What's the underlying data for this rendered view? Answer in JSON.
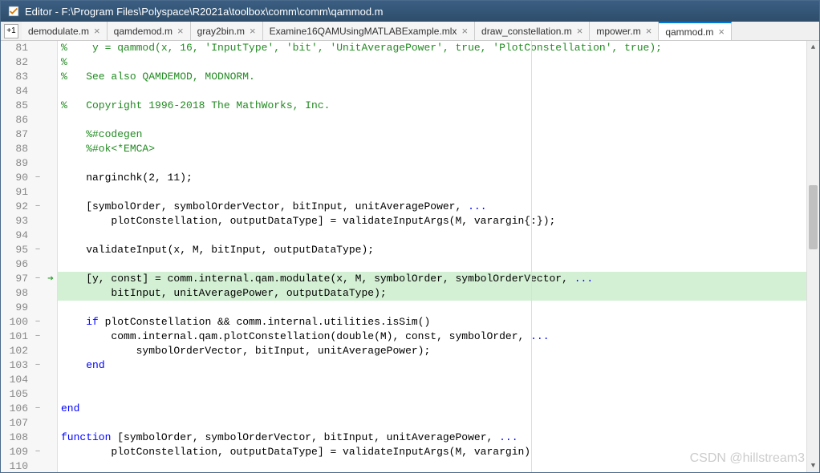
{
  "titlebar": {
    "text": "Editor - F:\\Program Files\\Polyspace\\R2021a\\toolbox\\comm\\comm\\qammod.m"
  },
  "tabs": {
    "expand_label": "+1",
    "items": [
      {
        "label": "demodulate.m",
        "active": false
      },
      {
        "label": "qamdemod.m",
        "active": false
      },
      {
        "label": "gray2bin.m",
        "active": false
      },
      {
        "label": "Examine16QAMUsingMATLABExample.mlx",
        "active": false
      },
      {
        "label": "draw_constellation.m",
        "active": false
      },
      {
        "label": "mpower.m",
        "active": false
      },
      {
        "label": "qammod.m",
        "active": true
      }
    ]
  },
  "code": {
    "lines": [
      {
        "num": 81,
        "fold": "",
        "arrow": "",
        "hl": false,
        "segs": [
          {
            "cls": "c-comment",
            "t": "%    y = qammod(x, 16, 'InputType', 'bit', 'UnitAveragePower', true, 'PlotConstellation', true);"
          }
        ]
      },
      {
        "num": 82,
        "fold": "",
        "arrow": "",
        "hl": false,
        "segs": [
          {
            "cls": "c-comment",
            "t": "%"
          }
        ]
      },
      {
        "num": 83,
        "fold": "",
        "arrow": "",
        "hl": false,
        "segs": [
          {
            "cls": "c-comment",
            "t": "%   See also QAMDEMOD, MODNORM."
          }
        ]
      },
      {
        "num": 84,
        "fold": "",
        "arrow": "",
        "hl": false,
        "segs": []
      },
      {
        "num": 85,
        "fold": "",
        "arrow": "",
        "hl": false,
        "segs": [
          {
            "cls": "c-comment",
            "t": "%   Copyright 1996-2018 The MathWorks, Inc."
          }
        ]
      },
      {
        "num": 86,
        "fold": "",
        "arrow": "",
        "hl": false,
        "segs": []
      },
      {
        "num": 87,
        "fold": "",
        "arrow": "",
        "hl": false,
        "segs": [
          {
            "cls": "c-comment",
            "t": "    %#codegen"
          }
        ]
      },
      {
        "num": 88,
        "fold": "",
        "arrow": "",
        "hl": false,
        "segs": [
          {
            "cls": "c-comment",
            "t": "    %#ok<*EMCA>"
          }
        ]
      },
      {
        "num": 89,
        "fold": "",
        "arrow": "",
        "hl": false,
        "segs": []
      },
      {
        "num": 90,
        "fold": "−",
        "arrow": "",
        "hl": false,
        "segs": [
          {
            "cls": "c-text",
            "t": "    narginchk(2, 11);"
          }
        ]
      },
      {
        "num": 91,
        "fold": "",
        "arrow": "",
        "hl": false,
        "segs": []
      },
      {
        "num": 92,
        "fold": "−",
        "arrow": "",
        "hl": false,
        "segs": [
          {
            "cls": "c-text",
            "t": "    [symbolOrder, symbolOrderVector, bitInput, unitAveragePower, "
          },
          {
            "cls": "c-keyword",
            "t": "..."
          }
        ]
      },
      {
        "num": 93,
        "fold": "",
        "arrow": "",
        "hl": false,
        "segs": [
          {
            "cls": "c-text",
            "t": "        plotConstellation, outputDataType] = validateInputArgs(M, varargin{:});"
          }
        ]
      },
      {
        "num": 94,
        "fold": "",
        "arrow": "",
        "hl": false,
        "segs": []
      },
      {
        "num": 95,
        "fold": "−",
        "arrow": "",
        "hl": false,
        "segs": [
          {
            "cls": "c-text",
            "t": "    validateInput(x, M, bitInput, outputDataType);"
          }
        ]
      },
      {
        "num": 96,
        "fold": "",
        "arrow": "",
        "hl": false,
        "segs": []
      },
      {
        "num": 97,
        "fold": "−",
        "arrow": "➔",
        "hl": true,
        "segs": [
          {
            "cls": "c-text",
            "t": "    [y, const] = comm.internal.qam.modulate(x, M, symbolOrder, symbolOrderVector, "
          },
          {
            "cls": "c-keyword",
            "t": "..."
          }
        ]
      },
      {
        "num": 98,
        "fold": "",
        "arrow": "",
        "hl": true,
        "segs": [
          {
            "cls": "c-text",
            "t": "        bitInput, unitAveragePower, outputDataType);"
          }
        ]
      },
      {
        "num": 99,
        "fold": "",
        "arrow": "",
        "hl": false,
        "segs": []
      },
      {
        "num": 100,
        "fold": "−",
        "arrow": "",
        "hl": false,
        "segs": [
          {
            "cls": "c-text",
            "t": "    "
          },
          {
            "cls": "c-keyword",
            "t": "if"
          },
          {
            "cls": "c-text",
            "t": " plotConstellation && comm.internal.utilities.isSim()"
          }
        ]
      },
      {
        "num": 101,
        "fold": "−",
        "arrow": "",
        "hl": false,
        "segs": [
          {
            "cls": "c-text",
            "t": "        comm.internal.qam.plotConstellation(double(M), const, symbolOrder, "
          },
          {
            "cls": "c-keyword",
            "t": "..."
          }
        ]
      },
      {
        "num": 102,
        "fold": "",
        "arrow": "",
        "hl": false,
        "segs": [
          {
            "cls": "c-text",
            "t": "            symbolOrderVector, bitInput, unitAveragePower);"
          }
        ]
      },
      {
        "num": 103,
        "fold": "−",
        "arrow": "",
        "hl": false,
        "segs": [
          {
            "cls": "c-text",
            "t": "    "
          },
          {
            "cls": "c-keyword",
            "t": "end"
          }
        ]
      },
      {
        "num": 104,
        "fold": "",
        "arrow": "",
        "hl": false,
        "segs": []
      },
      {
        "num": 105,
        "fold": "",
        "arrow": "",
        "hl": false,
        "segs": []
      },
      {
        "num": 106,
        "fold": "−",
        "arrow": "",
        "hl": false,
        "segs": [
          {
            "cls": "c-keyword",
            "t": "end"
          }
        ]
      },
      {
        "num": 107,
        "fold": "",
        "arrow": "",
        "hl": false,
        "segs": []
      },
      {
        "num": 108,
        "fold": "",
        "arrow": "",
        "hl": false,
        "segs": [
          {
            "cls": "c-keyword",
            "t": "function"
          },
          {
            "cls": "c-text",
            "t": " [symbolOrder, symbolOrderVector, bitInput, unitAveragePower, "
          },
          {
            "cls": "c-keyword",
            "t": "..."
          }
        ]
      },
      {
        "num": 109,
        "fold": "−",
        "arrow": "",
        "hl": false,
        "segs": [
          {
            "cls": "c-text",
            "t": "        plotConstellation, outputDataType] = validateInputArgs(M, varargin)"
          }
        ]
      },
      {
        "num": 110,
        "fold": "",
        "arrow": "",
        "hl": false,
        "segs": []
      }
    ]
  },
  "watermark": "CSDN @hillstream3"
}
